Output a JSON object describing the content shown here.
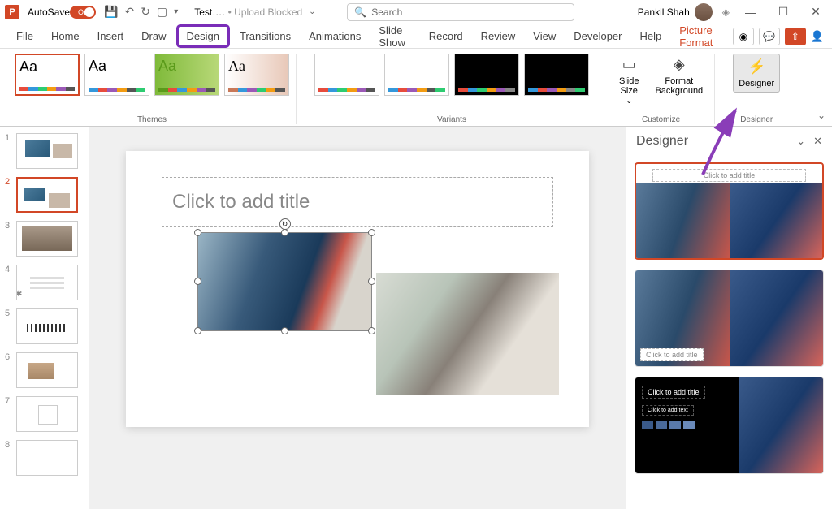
{
  "titlebar": {
    "autosave_label": "AutoSave",
    "autosave_state": "On",
    "filename": "Test….",
    "upload_status": "• Upload Blocked",
    "search_placeholder": "Search",
    "user_name": "Pankil Shah"
  },
  "ribbon_tabs": [
    "File",
    "Home",
    "Insert",
    "Draw",
    "Design",
    "Transitions",
    "Animations",
    "Slide Show",
    "Record",
    "Review",
    "View",
    "Developer",
    "Help"
  ],
  "context_tab": "Picture Format",
  "active_tab": "Design",
  "ribbon": {
    "themes_label": "Themes",
    "variants_label": "Variants",
    "customize_label": "Customize",
    "designer_group_label": "Designer",
    "slide_size": "Slide\nSize",
    "format_bg": "Format\nBackground",
    "designer_btn": "Designer",
    "theme_aa": "Aa"
  },
  "slide": {
    "title_placeholder": "Click to add title"
  },
  "thumbnails": [
    1,
    2,
    3,
    4,
    5,
    6,
    7,
    8
  ],
  "active_slide": 2,
  "designer": {
    "title": "Designer",
    "card1_caption": "Click to add title",
    "card2_caption": "Click to add title",
    "card3_caption": "Click to add title",
    "card3_text": "Click to add text"
  },
  "swatch_colors": [
    "#e74c3c",
    "#3498db",
    "#2ecc71",
    "#f39c12",
    "#9b59b6",
    "#555555"
  ],
  "swatch_alt": [
    "#3498db",
    "#e74c3c",
    "#9b59b6",
    "#f39c12",
    "#555555",
    "#2ecc71"
  ]
}
